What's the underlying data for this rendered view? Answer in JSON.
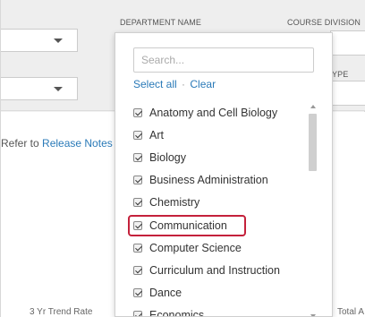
{
  "header": {
    "department_label": "DEPARTMENT NAME",
    "division_label": "COURSE DIVISION",
    "type_label_partial": "YPE"
  },
  "content": {
    "refer_text": "Refer to ",
    "release_notes_link": "Release Notes",
    "footer_left": "3 Yr Trend Rate",
    "footer_right": "Total A"
  },
  "dropdown": {
    "search_placeholder": "Search...",
    "select_all": "Select all",
    "separator": "·",
    "clear": "Clear",
    "items": [
      {
        "label": "Anatomy and Cell Biology",
        "checked": true
      },
      {
        "label": "Art",
        "checked": true
      },
      {
        "label": "Biology",
        "checked": true
      },
      {
        "label": "Business Administration",
        "checked": true
      },
      {
        "label": "Chemistry",
        "checked": true
      },
      {
        "label": "Communication",
        "checked": true
      },
      {
        "label": "Computer Science",
        "checked": true
      },
      {
        "label": "Curriculum and Instruction",
        "checked": true
      },
      {
        "label": "Dance",
        "checked": true
      },
      {
        "label": "Economics",
        "checked": true
      }
    ],
    "highlighted_item": "Communication",
    "highlight_color": "#c4213b",
    "link_color": "#2a7ab8"
  }
}
